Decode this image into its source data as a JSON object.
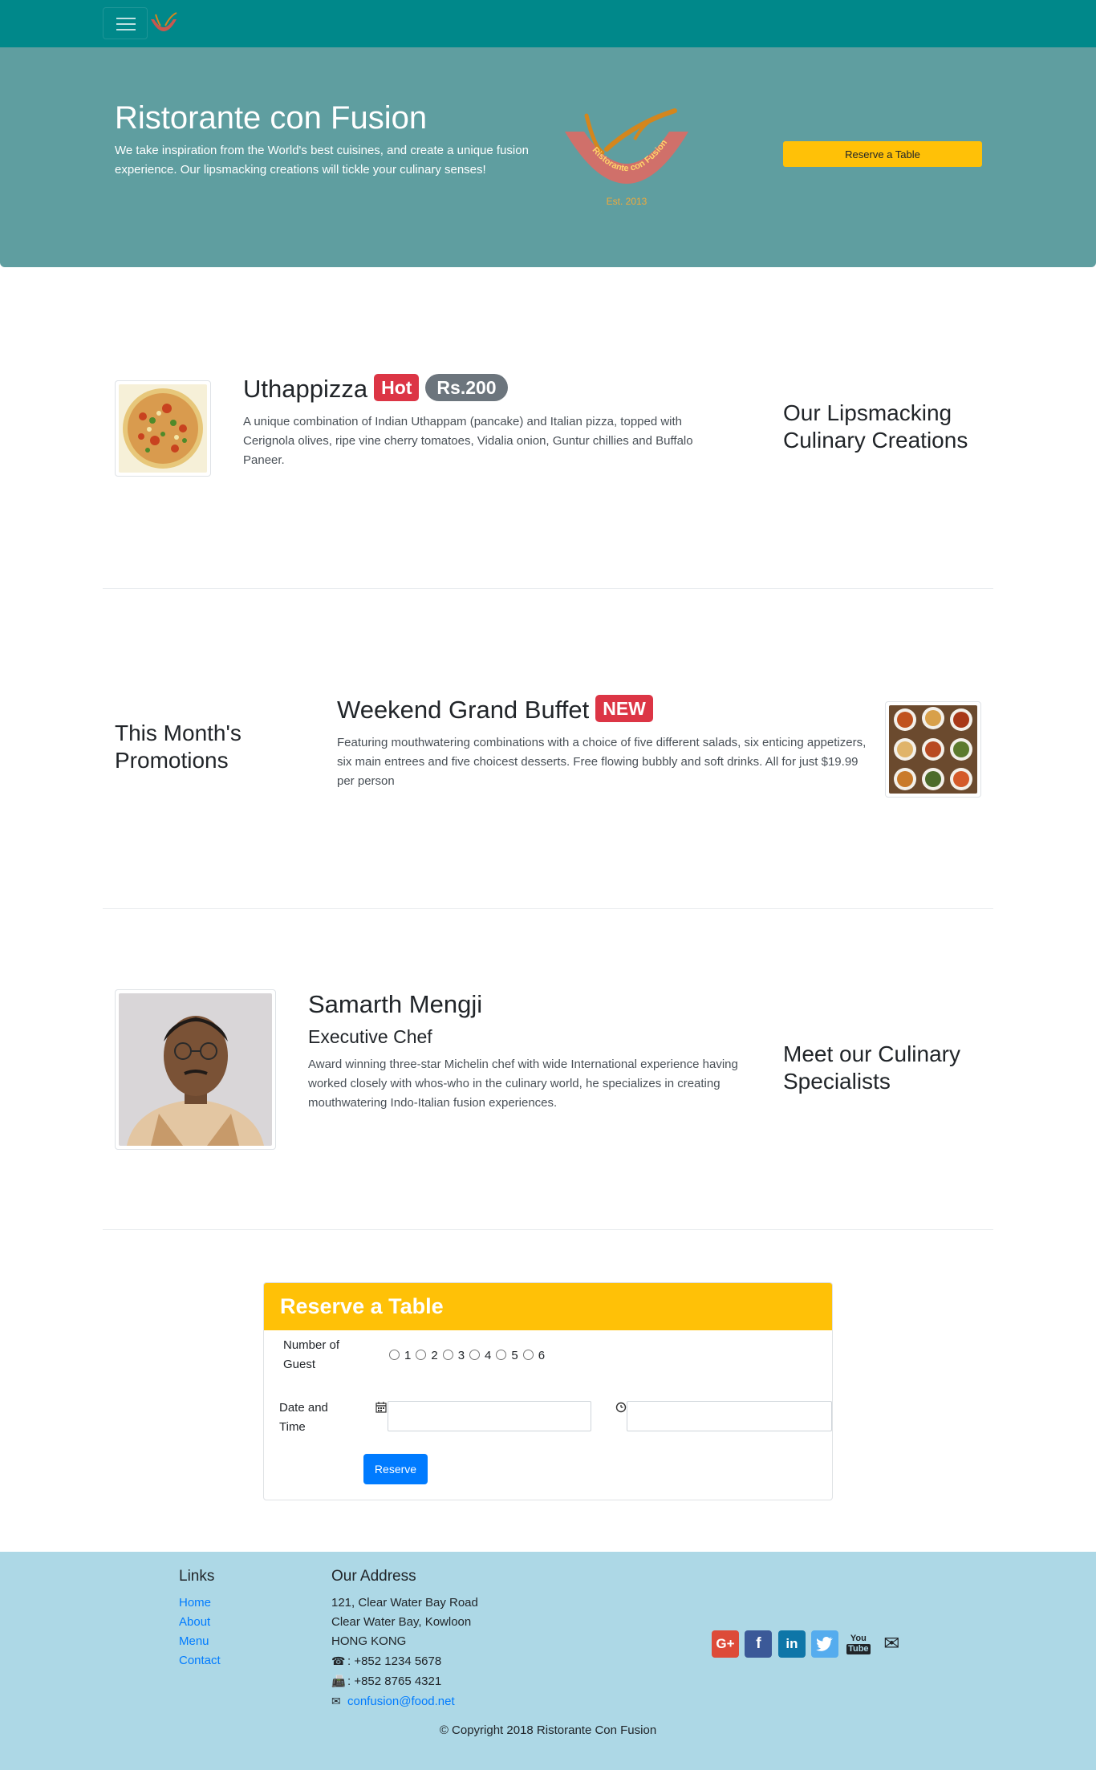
{
  "nav": {
    "brand_alt": "Ristorante con Fusion logo"
  },
  "jumbotron": {
    "title": "Ristorante con Fusion",
    "text": "We take inspiration from the World's best cuisines, and create a unique fusion experience. Our lipsmacking creations will tickle your culinary senses!",
    "logo_arc_text": "Ristorante con Fusion",
    "logo_est": "Est. 2013",
    "reserve_button": "Reserve a Table"
  },
  "dish": {
    "name": "Uthappizza",
    "badge_hot": "Hot",
    "badge_price": "Rs.200",
    "description": "A unique combination of Indian Uthappam (pancake) and Italian pizza, topped with Cerignola olives, ripe vine cherry tomatoes, Vidalia onion, Guntur chillies and Buffalo Paneer.",
    "side_heading": "Our Lipsmacking Culinary Creations"
  },
  "promotion": {
    "side_heading": "This Month's Promotions",
    "name": "Weekend Grand Buffet",
    "badge_new": "NEW",
    "description": "Featuring mouthwatering combinations with a choice of five different salads, six enticing appetizers, six main entrees and five choicest desserts. Free flowing bubbly and soft drinks. All for just $19.99 per person"
  },
  "leader": {
    "name": "Samarth Mengji",
    "designation": "Executive Chef",
    "description": "Award winning three-star Michelin chef with wide International experience having worked closely with whos-who in the culinary world, he specializes in creating mouthwatering Indo-Italian fusion experiences.",
    "side_heading": "Meet our Culinary Specialists"
  },
  "reservation": {
    "header": "Reserve a Table",
    "guests_label": "Number of Guest",
    "guest_options": [
      "1",
      "2",
      "3",
      "4",
      "5",
      "6"
    ],
    "datetime_label": "Date and Time",
    "date_value": "",
    "time_value": "",
    "submit": "Reserve"
  },
  "footer": {
    "links_heading": "Links",
    "links": [
      "Home",
      "About",
      "Menu",
      "Contact"
    ],
    "address_heading": "Our Address",
    "address_lines": [
      "121, Clear Water Bay Road",
      "Clear Water Bay, Kowloon",
      "HONG KONG"
    ],
    "phone": ": +852 1234 5678",
    "fax": ": +852 8765 4321",
    "email": "confusion@food.net",
    "social": [
      "google-plus-icon",
      "facebook-icon",
      "linkedin-icon",
      "twitter-icon",
      "youtube-icon",
      "envelope-icon"
    ],
    "copyright": "© Copyright 2018 Ristorante Con Fusion"
  },
  "colors": {
    "navbar": "#00888a",
    "jumbotron": "#5f9ea0",
    "accent": "#ffc107",
    "footer": "#add8e6",
    "primary": "#007bff",
    "danger": "#dc3545"
  }
}
